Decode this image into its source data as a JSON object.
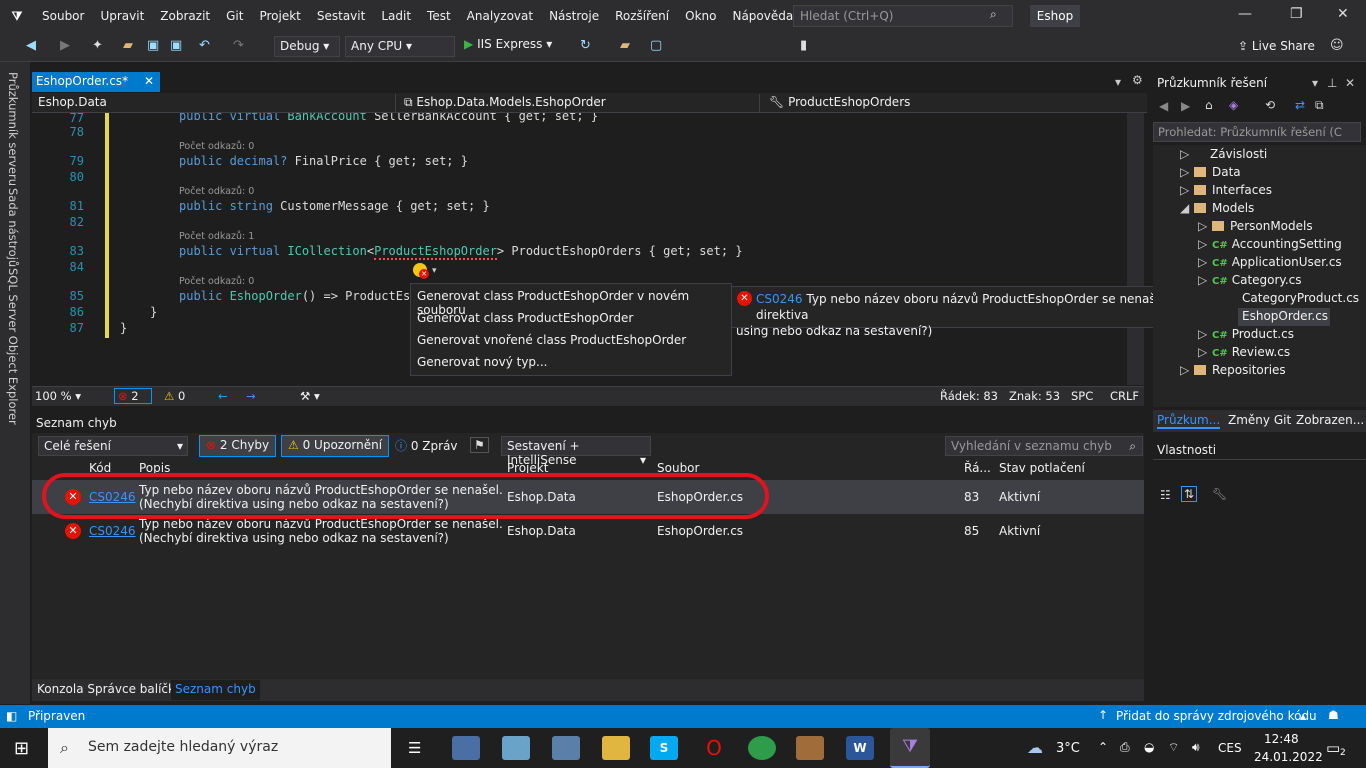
{
  "menu": [
    "Soubor",
    "Upravit",
    "Zobrazit",
    "Git",
    "Projekt",
    "Sestavit",
    "Ladit",
    "Test",
    "Analyzovat",
    "Nástroje",
    "Rozšíření",
    "Okno",
    "Nápověda"
  ],
  "quick_search_placeholder": "Hledat (Ctrl+Q)",
  "solution_name": "Eshop",
  "toolbar": {
    "config": "Debug",
    "platform": "Any CPU",
    "run": "IIS Express",
    "live_share": "Live Share"
  },
  "left_tabs": [
    "Průzkumník serveru",
    "Sada nástrojů",
    "SQL Server Object Explorer"
  ],
  "doc_tab": "EshopOrder.cs*",
  "nav": {
    "project": "Eshop.Data",
    "type": "Eshop.Data.Models.EshopOrder",
    "member": "ProductEshopOrders"
  },
  "code": {
    "lines": [
      {
        "n": "77",
        "lens": "",
        "pre": "public virtual ",
        "type": "BankAccount",
        "post": " SellerBankAccount { get; set; }"
      },
      {
        "n": "78",
        "lens": "Počet odkazů: 0",
        "pre": "",
        "type": "",
        "post": ""
      },
      {
        "n": "79",
        "lens": "",
        "pre": "public decimal? ",
        "type": "",
        "post": "FinalPrice { get; set; }"
      },
      {
        "n": "80",
        "lens": "Počet odkazů: 0",
        "pre": "",
        "type": "",
        "post": ""
      },
      {
        "n": "81",
        "lens": "",
        "pre": "public string ",
        "type": "",
        "post": "CustomerMessage { get; set; }"
      },
      {
        "n": "82",
        "lens": "Počet odkazů: 1",
        "pre": "",
        "type": "",
        "post": ""
      },
      {
        "n": "83",
        "lens": "",
        "pre": "public virtual ",
        "type": "ICollection",
        "post": ""
      },
      {
        "n": "84",
        "lens": "Počet odkazů: 0",
        "pre": "",
        "type": "",
        "post": ""
      },
      {
        "n": "85",
        "lens": "",
        "pre": "public ",
        "type": "EshopOrder",
        "post": "() => ProductEsh"
      },
      {
        "n": "86",
        "lens": "",
        "pre": "}",
        "type": "",
        "post": ""
      },
      {
        "n": "87",
        "lens": "",
        "pre": "}",
        "type": "",
        "post": ""
      }
    ],
    "line83_generic": "ProductEshopOrder",
    "line83_rest": "> ProductEshopOrders { get; set; }"
  },
  "quick_actions": [
    "Generovat class ProductEshopOrder v novém souboru",
    "Generovat class ProductEshopOrder",
    "Generovat vnořené class ProductEshopOrder",
    "Generovat nový typ..."
  ],
  "tooltip": {
    "code": "CS0246",
    "text": "Typ nebo název oboru názvů ProductEshopOrder se nenašel. (Nechybí direktiva",
    "text2": "using nebo odkaz na sestavení?)"
  },
  "editor_status": {
    "zoom": "100 %",
    "errors": "2",
    "warnings": "0",
    "line": "Řádek: 83",
    "col": "Znak: 53",
    "spc": "SPC",
    "eol": "CRLF"
  },
  "solution_explorer": {
    "title": "Průzkumník řešení",
    "search_placeholder": "Prohledat: Průzkumník řešení (C",
    "nodes": [
      "Závislosti",
      "Data",
      "Interfaces",
      "Models",
      "PersonModels",
      "AccountingSetting",
      "ApplicationUser.cs",
      "Category.cs",
      "CategoryProduct.cs",
      "EshopOrder.cs",
      "Product.cs",
      "Review.cs",
      "Repositories"
    ],
    "tabs": [
      "Průzkum...",
      "Změny Git",
      "Zobrazen..."
    ]
  },
  "properties_title": "Vlastnosti",
  "error_list": {
    "title": "Seznam chyb",
    "scope": "Celé řešení",
    "errors_btn": "2 Chyby",
    "warnings_btn": "0 Upozornění",
    "messages_btn": "0 Zpráv",
    "source": "Sestavení + IntelliSense",
    "search_placeholder": "Vyhledání v seznamu chyb",
    "headers": [
      "Kód",
      "Popis",
      "Projekt",
      "Soubor",
      "Řá...",
      "Stav potlačení"
    ],
    "rows": [
      {
        "code": "CS0246",
        "desc1": "Typ nebo název oboru názvů ProductEshopOrder se nenašel.",
        "desc2": "(Nechybí direktiva using nebo odkaz na sestavení?)",
        "project": "Eshop.Data",
        "file": "EshopOrder.cs",
        "line": "83",
        "state": "Aktivní"
      },
      {
        "code": "CS0246",
        "desc1": "Typ nebo název oboru názvů ProductEshopOrder se nenašel.",
        "desc2": "(Nechybí direktiva using nebo odkaz na sestavení?)",
        "project": "Eshop.Data",
        "file": "EshopOrder.cs",
        "line": "85",
        "state": "Aktivní"
      }
    ],
    "bottom_tabs": [
      "Konzola Správce balíčků",
      "Seznam chyb"
    ]
  },
  "status_bar": {
    "left": "Připraven",
    "right": "Přidat do správy zdrojového kódu"
  },
  "taskbar": {
    "search": "Sem zadejte hledaný výraz",
    "weather": "3°C",
    "lang": "CES",
    "time": "12:48",
    "date": "24.01.2022",
    "notif": "2"
  },
  "colors": {
    "accent": "#007acc",
    "error": "#e51400",
    "highlight_ellipse": "#e0141e"
  }
}
